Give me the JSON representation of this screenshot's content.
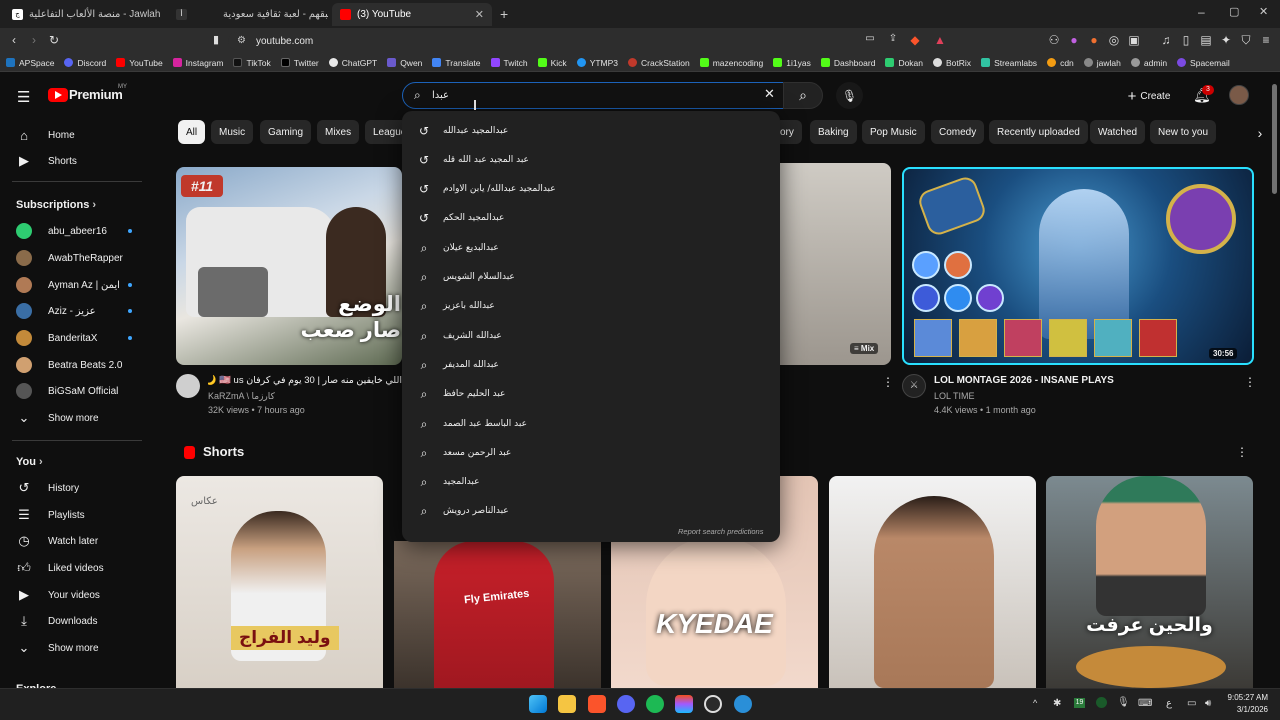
{
  "browser": {
    "tabs": [
      {
        "title": "جولة | Jawlah - منصة الألعاب التفاعلية",
        "active": false
      },
      {
        "title": "اسبقهم - لعبة ثقافية سعودية",
        "active": false
      },
      {
        "title": "(3) YouTube",
        "active": true
      }
    ],
    "url": "youtube.com",
    "bookmarks": [
      "APSpace",
      "Discord",
      "YouTube",
      "Instagram",
      "TikTok",
      "Twitter",
      "ChatGPT",
      "Qwen",
      "Translate",
      "Twitch",
      "Kick",
      "YTMP3",
      "CrackStation",
      "mazencoding",
      "1i1yas",
      "Dashboard",
      "Dokan",
      "BotRix",
      "Streamlabs",
      "cdn",
      "jawlah",
      "admin",
      "Spacemail"
    ]
  },
  "youtube": {
    "logo_text": "Premium",
    "logo_region": "MY",
    "search": {
      "value": "عبدا",
      "placeholder": "Search"
    },
    "create_label": "Create",
    "notifications_count": "3",
    "sidebar": {
      "main": [
        {
          "label": "Home",
          "icon": "home-icon"
        },
        {
          "label": "Shorts",
          "icon": "shorts-icon"
        }
      ],
      "subscriptions_title": "Subscriptions",
      "subscriptions": [
        {
          "label": "abu_abeer16",
          "color": "#2ecc71",
          "dot": true
        },
        {
          "label": "AwabTheRapper",
          "color": "#8a6b4a",
          "dot": false
        },
        {
          "label": "Ayman Az | ايمن",
          "color": "#b07a55",
          "dot": true
        },
        {
          "label": "Aziz - عزيز",
          "color": "#3a6ea5",
          "dot": true
        },
        {
          "label": "BanderitaX",
          "color": "#c38a3a",
          "dot": true
        },
        {
          "label": "Beatra Beats 2.0",
          "color": "#d0a070",
          "dot": false
        },
        {
          "label": "BiGSaM Official",
          "color": "#555555",
          "dot": false
        }
      ],
      "show_more": "Show more",
      "you_title": "You",
      "you": [
        {
          "label": "History",
          "icon": "history-icon"
        },
        {
          "label": "Playlists",
          "icon": "playlists-icon"
        },
        {
          "label": "Watch later",
          "icon": "watch-later-icon"
        },
        {
          "label": "Liked videos",
          "icon": "like-icon"
        },
        {
          "label": "Your videos",
          "icon": "your-videos-icon"
        },
        {
          "label": "Downloads",
          "icon": "download-icon"
        }
      ],
      "show_more_2": "Show more",
      "explore_cut": "Explore"
    },
    "chips": [
      "All",
      "Music",
      "Gaming",
      "Mixes",
      "League",
      "ory",
      "Baking",
      "Pop Music",
      "Comedy",
      "Recently uploaded",
      "Watched",
      "New to you"
    ],
    "suggestions": [
      {
        "text": "عبدالمجيد عبدالله",
        "type": "history"
      },
      {
        "text": "عبد المجيد عبد الله قله",
        "type": "history"
      },
      {
        "text": "عبدالمجيد عبدالله/ يابن الاوادم",
        "type": "history"
      },
      {
        "text": "عبدالمجيد الحكم",
        "type": "history"
      },
      {
        "text": "عبدالبديع عيلان",
        "type": "search"
      },
      {
        "text": "عبدالسلام الشويس",
        "type": "search"
      },
      {
        "text": "عبدالله باعزيز",
        "type": "search"
      },
      {
        "text": "عبدالله الشريف",
        "type": "search"
      },
      {
        "text": "عبدالله المديفر",
        "type": "search"
      },
      {
        "text": "عبد الحليم حافظ",
        "type": "search"
      },
      {
        "text": "عبد الباسط عبد الصمد",
        "type": "search"
      },
      {
        "text": "عبد الرحمن مسعد",
        "type": "search"
      },
      {
        "text": "عبدالمجيد",
        "type": "search"
      },
      {
        "text": "عبدالناصر درويش",
        "type": "search"
      }
    ],
    "report_label": "Report search predictions",
    "videos": [
      {
        "title": "اللي خايفين منه صار | 30 يوم في كرفان 🇺🇸 us 🌙",
        "channel": "KaRZmA \\ كارزما",
        "meta": "32K views • 7 hours ago",
        "badge": "#11",
        "overlay_text": "الوضع صار صعب"
      },
      {
        "title": "",
        "channel": "",
        "meta": "",
        "badge": "Mix"
      },
      {
        "title": "LOL MONTAGE 2026 - INSANE PLAYS",
        "channel": "LOL TIME",
        "meta": "4.4K views • 1 month ago",
        "duration": "30:56"
      }
    ],
    "shorts_title": "Shorts",
    "shorts": [
      {
        "caption": "وليد الفراج",
        "top_text": "عكاس"
      },
      {
        "caption": "Fly Emirates",
        "top_text": ""
      },
      {
        "caption": "KYEDAE",
        "top_text": ""
      },
      {
        "caption": "",
        "top_text": ""
      },
      {
        "caption": "والحين عرفت",
        "top_text": ""
      }
    ]
  },
  "taskbar": {
    "time": "9:05:27 AM",
    "date": "3/1/2026",
    "lang": "ع"
  },
  "colors": {
    "accent": "#3ea6ff",
    "yt_red": "#ff0000",
    "bg": "#0f0f0f"
  }
}
